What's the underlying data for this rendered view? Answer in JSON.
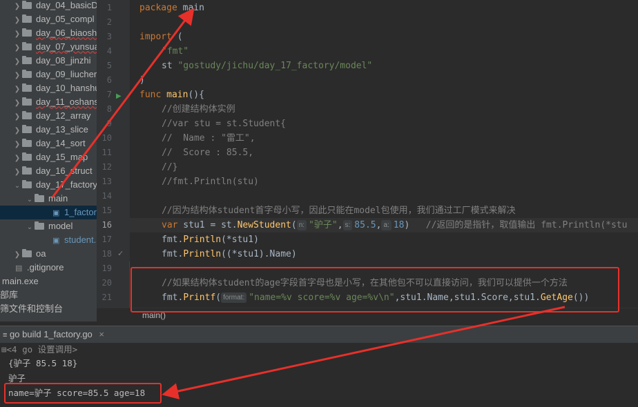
{
  "sidebar": {
    "items": [
      {
        "label": "day_04_basicD"
      },
      {
        "label": "day_05_compl"
      },
      {
        "label": "day_06_biaosh"
      },
      {
        "label": "day_07_yunsua"
      },
      {
        "label": "day_08_jinzhi"
      },
      {
        "label": "day_09_liucher"
      },
      {
        "label": "day_10_hanshu"
      },
      {
        "label": "day_11_oshans"
      },
      {
        "label": "day_12_array"
      },
      {
        "label": "day_13_slice"
      },
      {
        "label": "day_14_sort"
      },
      {
        "label": "day_15_map"
      },
      {
        "label": "day_16_struct"
      },
      {
        "label": "day_17_factory"
      },
      {
        "label": "main"
      },
      {
        "label": "1_factor"
      },
      {
        "label": "model"
      },
      {
        "label": "student."
      },
      {
        "label": "oa"
      },
      {
        "label": ".gitignore"
      },
      {
        "label": "main.exe"
      },
      {
        "label": "部库"
      },
      {
        "label": "筛文件和控制台"
      }
    ]
  },
  "editor": {
    "line_numbers": [
      "1",
      "2",
      "3",
      "4",
      "5",
      "6",
      "7",
      "8",
      "9",
      "10",
      "11",
      "12",
      "13",
      "14",
      "15",
      "16",
      "17",
      "18",
      "19",
      "20",
      "21"
    ],
    "lines": {
      "l1_kw": "package",
      "l1_name": " main",
      "l3_kw": "import",
      "l3_rest": " (",
      "l4": "\"fmt\"",
      "l5_st": "st ",
      "l5_path": "\"gostudy/jichu/day_17_factory/model\"",
      "l6": ")",
      "l7_kw": "func",
      "l7_fn": " main",
      "l7_rest": "(){",
      "l8": "//创建结构体实例",
      "l9": "//var stu = st.Student{",
      "l10": "//  Name : \"雷工\",",
      "l11": "//  Score : 85.5,",
      "l12": "//}",
      "l13": "//fmt.Println(stu)",
      "l15": "//因为结构体student首字母小写，因此只能在model包使用，我们通过工厂模式来解决",
      "l16_kw": "var",
      "l16_a": " stu1 = st.",
      "l16_fn": "NewStudent",
      "l16_b": "(",
      "l16_hint_n": "n:",
      "l16_s1": "\"驴子\"",
      "l16_c1": ",",
      "l16_hint_s": "s:",
      "l16_n1": "85.5",
      "l16_c2": ",",
      "l16_hint_a": "a:",
      "l16_n2": "18",
      "l16_c3": ")",
      "l16_cm": "   //返回的是指针，取值输出 fmt.Println(*stu",
      "l17_a": "fmt.",
      "l17_fn": "Println",
      "l17_b": "(*stu1)",
      "l18_a": "fmt.",
      "l18_fn": "Println",
      "l18_b": "((*stu1).Name)",
      "l20": "//如果结构体student的age字段首字母也是小写，在其他包不可以直接访问，我们可以提供一个方法",
      "l21_a": "fmt.",
      "l21_fn": "Printf",
      "l21_b": "(",
      "l21_hint": "format:",
      "l21_s": "\"name=%v score=%v age=%v\\n\"",
      "l21_c": ",stu1.Name,stu1.Score,stu1.",
      "l21_fn2": "GetAge",
      "l21_e": "())"
    }
  },
  "breadcrumb": "main()",
  "run": {
    "tab_label": "go build 1_factory.go",
    "close_glyph": "×"
  },
  "console": {
    "lines": [
      "<4 go 设置调用>",
      "{驴子 85.5 18}",
      "驴子",
      "name=驴子 score=85.5 age=18"
    ]
  },
  "colors": {
    "annotation": "#e8302a",
    "keyword": "#cc7832",
    "string": "#6a8759",
    "comment": "#808080"
  }
}
